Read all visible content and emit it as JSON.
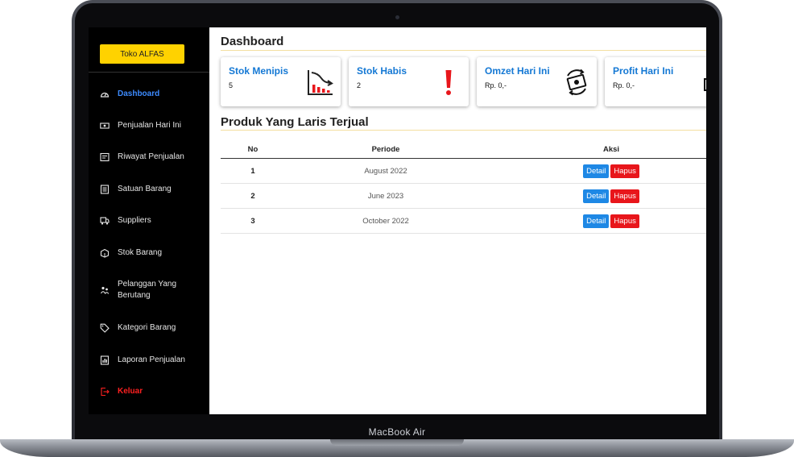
{
  "device": {
    "brand_label": "MacBook Air"
  },
  "sidebar": {
    "store_button": "Toko ALFAS",
    "items": [
      {
        "label": "Dashboard",
        "icon": "dashboard-gauge-icon",
        "state": "active"
      },
      {
        "label": "Penjualan Hari Ini",
        "icon": "cash-icon",
        "state": "normal"
      },
      {
        "label": "Riwayat Penjualan",
        "icon": "history-icon",
        "state": "normal"
      },
      {
        "label": "Satuan Barang",
        "icon": "list-icon",
        "state": "normal"
      },
      {
        "label": "Suppliers",
        "icon": "truck-icon",
        "state": "normal"
      },
      {
        "label": "Stok Barang",
        "icon": "box-icon",
        "state": "normal"
      },
      {
        "label": "Pelanggan Yang Berutang",
        "icon": "people-icon",
        "state": "normal"
      },
      {
        "label": "Kategori Barang",
        "icon": "tag-icon",
        "state": "normal"
      },
      {
        "label": "Laporan Penjualan",
        "icon": "report-icon",
        "state": "normal"
      },
      {
        "label": "Keluar",
        "icon": "logout-icon",
        "state": "danger"
      }
    ]
  },
  "main": {
    "title": "Dashboard",
    "cards": [
      {
        "title": "Stok Menipis",
        "value": "5",
        "icon": "declining-chart-icon"
      },
      {
        "title": "Stok Habis",
        "value": "2",
        "icon": "exclamation-icon"
      },
      {
        "title": "Omzet Hari Ini",
        "value": "Rp. 0,-",
        "icon": "money-exchange-icon"
      },
      {
        "title": "Profit Hari Ini",
        "value": "Rp. 0,-",
        "icon": "money-icon"
      }
    ],
    "section_title": "Produk Yang Laris Terjual",
    "table": {
      "headers": [
        "No",
        "Periode",
        "Aksi"
      ],
      "rows": [
        {
          "no": "1",
          "periode": "August 2022"
        },
        {
          "no": "2",
          "periode": "June 2023"
        },
        {
          "no": "3",
          "periode": "October 2022"
        }
      ],
      "detail_label": "Detail",
      "hapus_label": "Hapus"
    }
  },
  "colors": {
    "accent_yellow": "#ffd200",
    "link_blue": "#1478d4",
    "active_blue": "#3d8bff",
    "danger_red": "#ff2020",
    "detail_button": "#1e88e5",
    "hapus_button": "#e8161b"
  }
}
